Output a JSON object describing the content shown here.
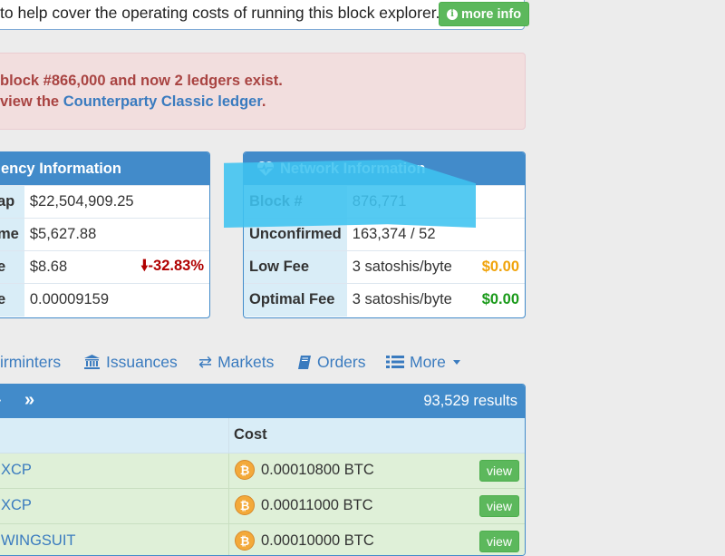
{
  "donate": {
    "text": "to help cover the operating costs of running this block explorer.",
    "more_info_label": "more info"
  },
  "alert": {
    "line1": "block #866,000 and now 2 ledgers exist.",
    "line2_prefix": "view the ",
    "line2_link": "Counterparty Classic ledger",
    "line2_suffix": "."
  },
  "currency_panel": {
    "title": "ency Information",
    "rows": [
      {
        "label": "ap",
        "value": "$22,504,909.25"
      },
      {
        "label": "me",
        "value": "$5,627.88"
      },
      {
        "label": "e",
        "value": "$8.68",
        "change": "-32.83%"
      },
      {
        "label": "e",
        "value": "0.00009159"
      }
    ]
  },
  "network_panel": {
    "title": "Network Information",
    "rows": [
      {
        "label": "Block #",
        "value": "876,771"
      },
      {
        "label": "Unconfirmed",
        "value": "163,374 / 52"
      },
      {
        "label": "Low Fee",
        "value": "3 satoshis/byte",
        "fee": "$0.00"
      },
      {
        "label": "Optimal Fee",
        "value": "3 satoshis/byte",
        "fee": "$0.00"
      }
    ]
  },
  "nav": {
    "items": [
      {
        "label": "irminters"
      },
      {
        "label": "Issuances"
      },
      {
        "label": "Markets"
      },
      {
        "label": "Orders"
      },
      {
        "label": "More"
      }
    ]
  },
  "results": {
    "count": "93,529 results",
    "pager_next": "›",
    "pager_last": "»",
    "column_cost": "Cost",
    "rows": [
      {
        "asset": "XCP",
        "cost": "0.00010800 BTC",
        "action": "view"
      },
      {
        "asset": "XCP",
        "cost": "0.00011000 BTC",
        "action": "view"
      },
      {
        "asset": "WINGSUIT",
        "cost": "0.00010000 BTC",
        "action": "view"
      }
    ]
  },
  "colors": {
    "primary": "#428bca",
    "success": "#5cb85c",
    "danger_text": "#a94442",
    "highlight": "#3dc3f0"
  }
}
